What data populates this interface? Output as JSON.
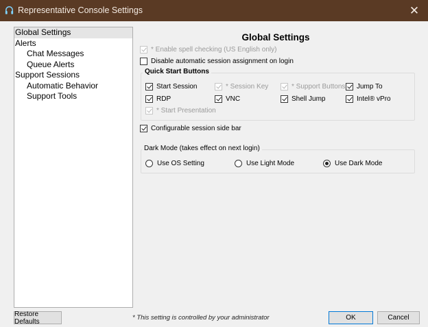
{
  "window": {
    "title": "Representative Console Settings",
    "close_glyph": "✕",
    "icon": "headset-icon"
  },
  "sidebar": {
    "items": [
      {
        "label": "Global Settings",
        "selected": true
      },
      {
        "label": "Alerts"
      },
      {
        "label": "Chat Messages"
      },
      {
        "label": "Queue Alerts"
      },
      {
        "label": "Support Sessions"
      },
      {
        "label": "Automatic Behavior"
      },
      {
        "label": "Support Tools"
      }
    ]
  },
  "main": {
    "title": "Global Settings",
    "spell_check": {
      "label": "* Enable spell checking (US English only)",
      "checked": true,
      "disabled": true
    },
    "disable_auto_assign": {
      "label": "Disable automatic session assignment on login",
      "checked": false
    },
    "quick_start": {
      "title": "Quick Start Buttons",
      "buttons": [
        {
          "label": "Start Session",
          "checked": true,
          "disabled": false
        },
        {
          "label": "* Session Key",
          "checked": true,
          "disabled": true
        },
        {
          "label": "* Support Buttons",
          "checked": true,
          "disabled": true
        },
        {
          "label": "Jump To",
          "checked": true,
          "disabled": false
        },
        {
          "label": "RDP",
          "checked": true,
          "disabled": false
        },
        {
          "label": "VNC",
          "checked": true,
          "disabled": false
        },
        {
          "label": "Shell Jump",
          "checked": true,
          "disabled": false
        },
        {
          "label": "Intel® vPro",
          "checked": true,
          "disabled": false
        },
        {
          "label": "* Start Presentation",
          "checked": true,
          "disabled": true
        }
      ]
    },
    "side_bar": {
      "label": "Configurable session side bar",
      "checked": true
    },
    "dark_mode": {
      "title": "Dark Mode (takes effect on next login)",
      "options": [
        {
          "label": "Use OS Setting",
          "selected": false
        },
        {
          "label": "Use Light Mode",
          "selected": false
        },
        {
          "label": "Use Dark Mode",
          "selected": true
        }
      ]
    }
  },
  "footer": {
    "restore_label": "Restore Defaults",
    "note": "* This setting is controlled by your administrator",
    "ok_label": "OK",
    "cancel_label": "Cancel"
  },
  "colors": {
    "titlebar": "#5a3a24",
    "accent": "#0078d7"
  }
}
